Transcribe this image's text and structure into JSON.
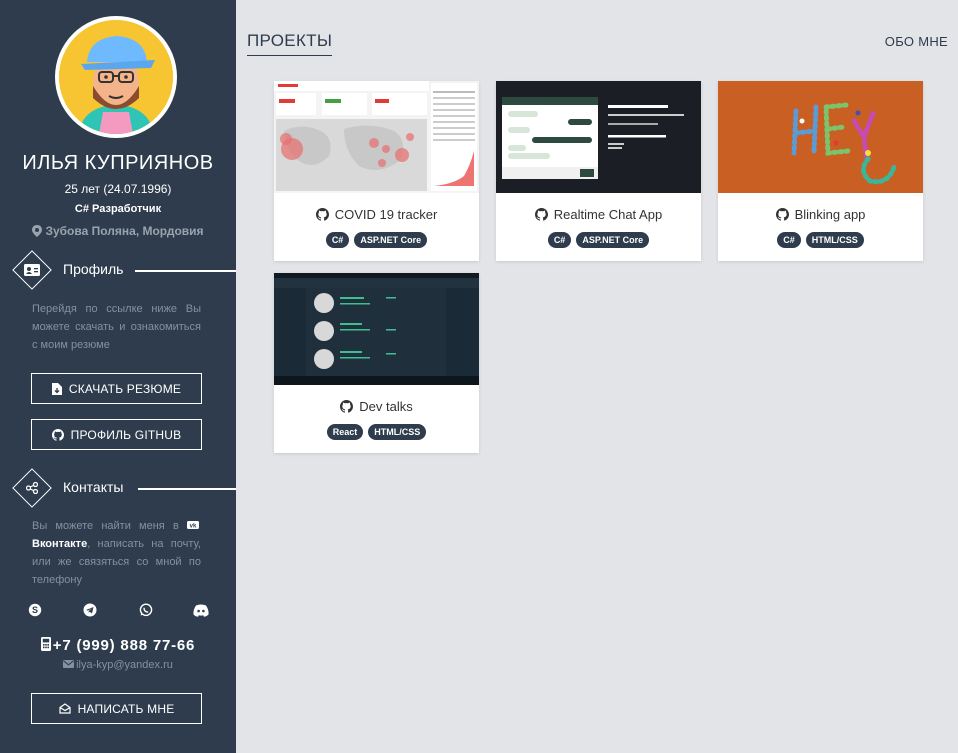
{
  "profile": {
    "name": "ИЛЬЯ КУПРИЯНОВ",
    "age": "25 лет (24.07.1996)",
    "role": "C# Разработчик",
    "location": "Зубова Поляна, Мордовия"
  },
  "profile_section": {
    "title": "Профиль",
    "text": "Перейдя по ссылке ниже Вы можете скачать и ознакомиться с моим резюме",
    "download_label": "СКАЧАТЬ РЕЗЮМЕ",
    "github_label": "ПРОФИЛЬ GITHUB"
  },
  "contacts_section": {
    "title": "Контакты",
    "text_before": "Вы можете найти меня в ",
    "vk_label": "Вконтакте",
    "text_after": ", написать на почту, или же связяться со мной по телефону",
    "socials": [
      "skype-icon",
      "telegram-icon",
      "whatsapp-icon",
      "discord-icon"
    ],
    "phone": "+7 (999) 888 77-66",
    "email": "ilya-kyp@yandex.ru",
    "write_label": "НАПИСАТЬ МНЕ"
  },
  "nav": {
    "projects": "ПРОЕКТЫ",
    "about": "ОБО МНЕ"
  },
  "projects": [
    {
      "title": "COVID 19 tracker",
      "tags": [
        "C#",
        "ASP.NET Core"
      ]
    },
    {
      "title": "Realtime Chat App",
      "tags": [
        "C#",
        "ASP.NET Core"
      ]
    },
    {
      "title": "Blinking app",
      "tags": [
        "C#",
        "HTML/CSS"
      ]
    },
    {
      "title": "Dev talks",
      "tags": [
        "React",
        "HTML/CSS"
      ]
    }
  ],
  "colors": {
    "sidebar": "#2e3c4d",
    "background": "#e3e4e8",
    "tag": "#2e3c4d",
    "avatar_bg": "#f7c531"
  }
}
